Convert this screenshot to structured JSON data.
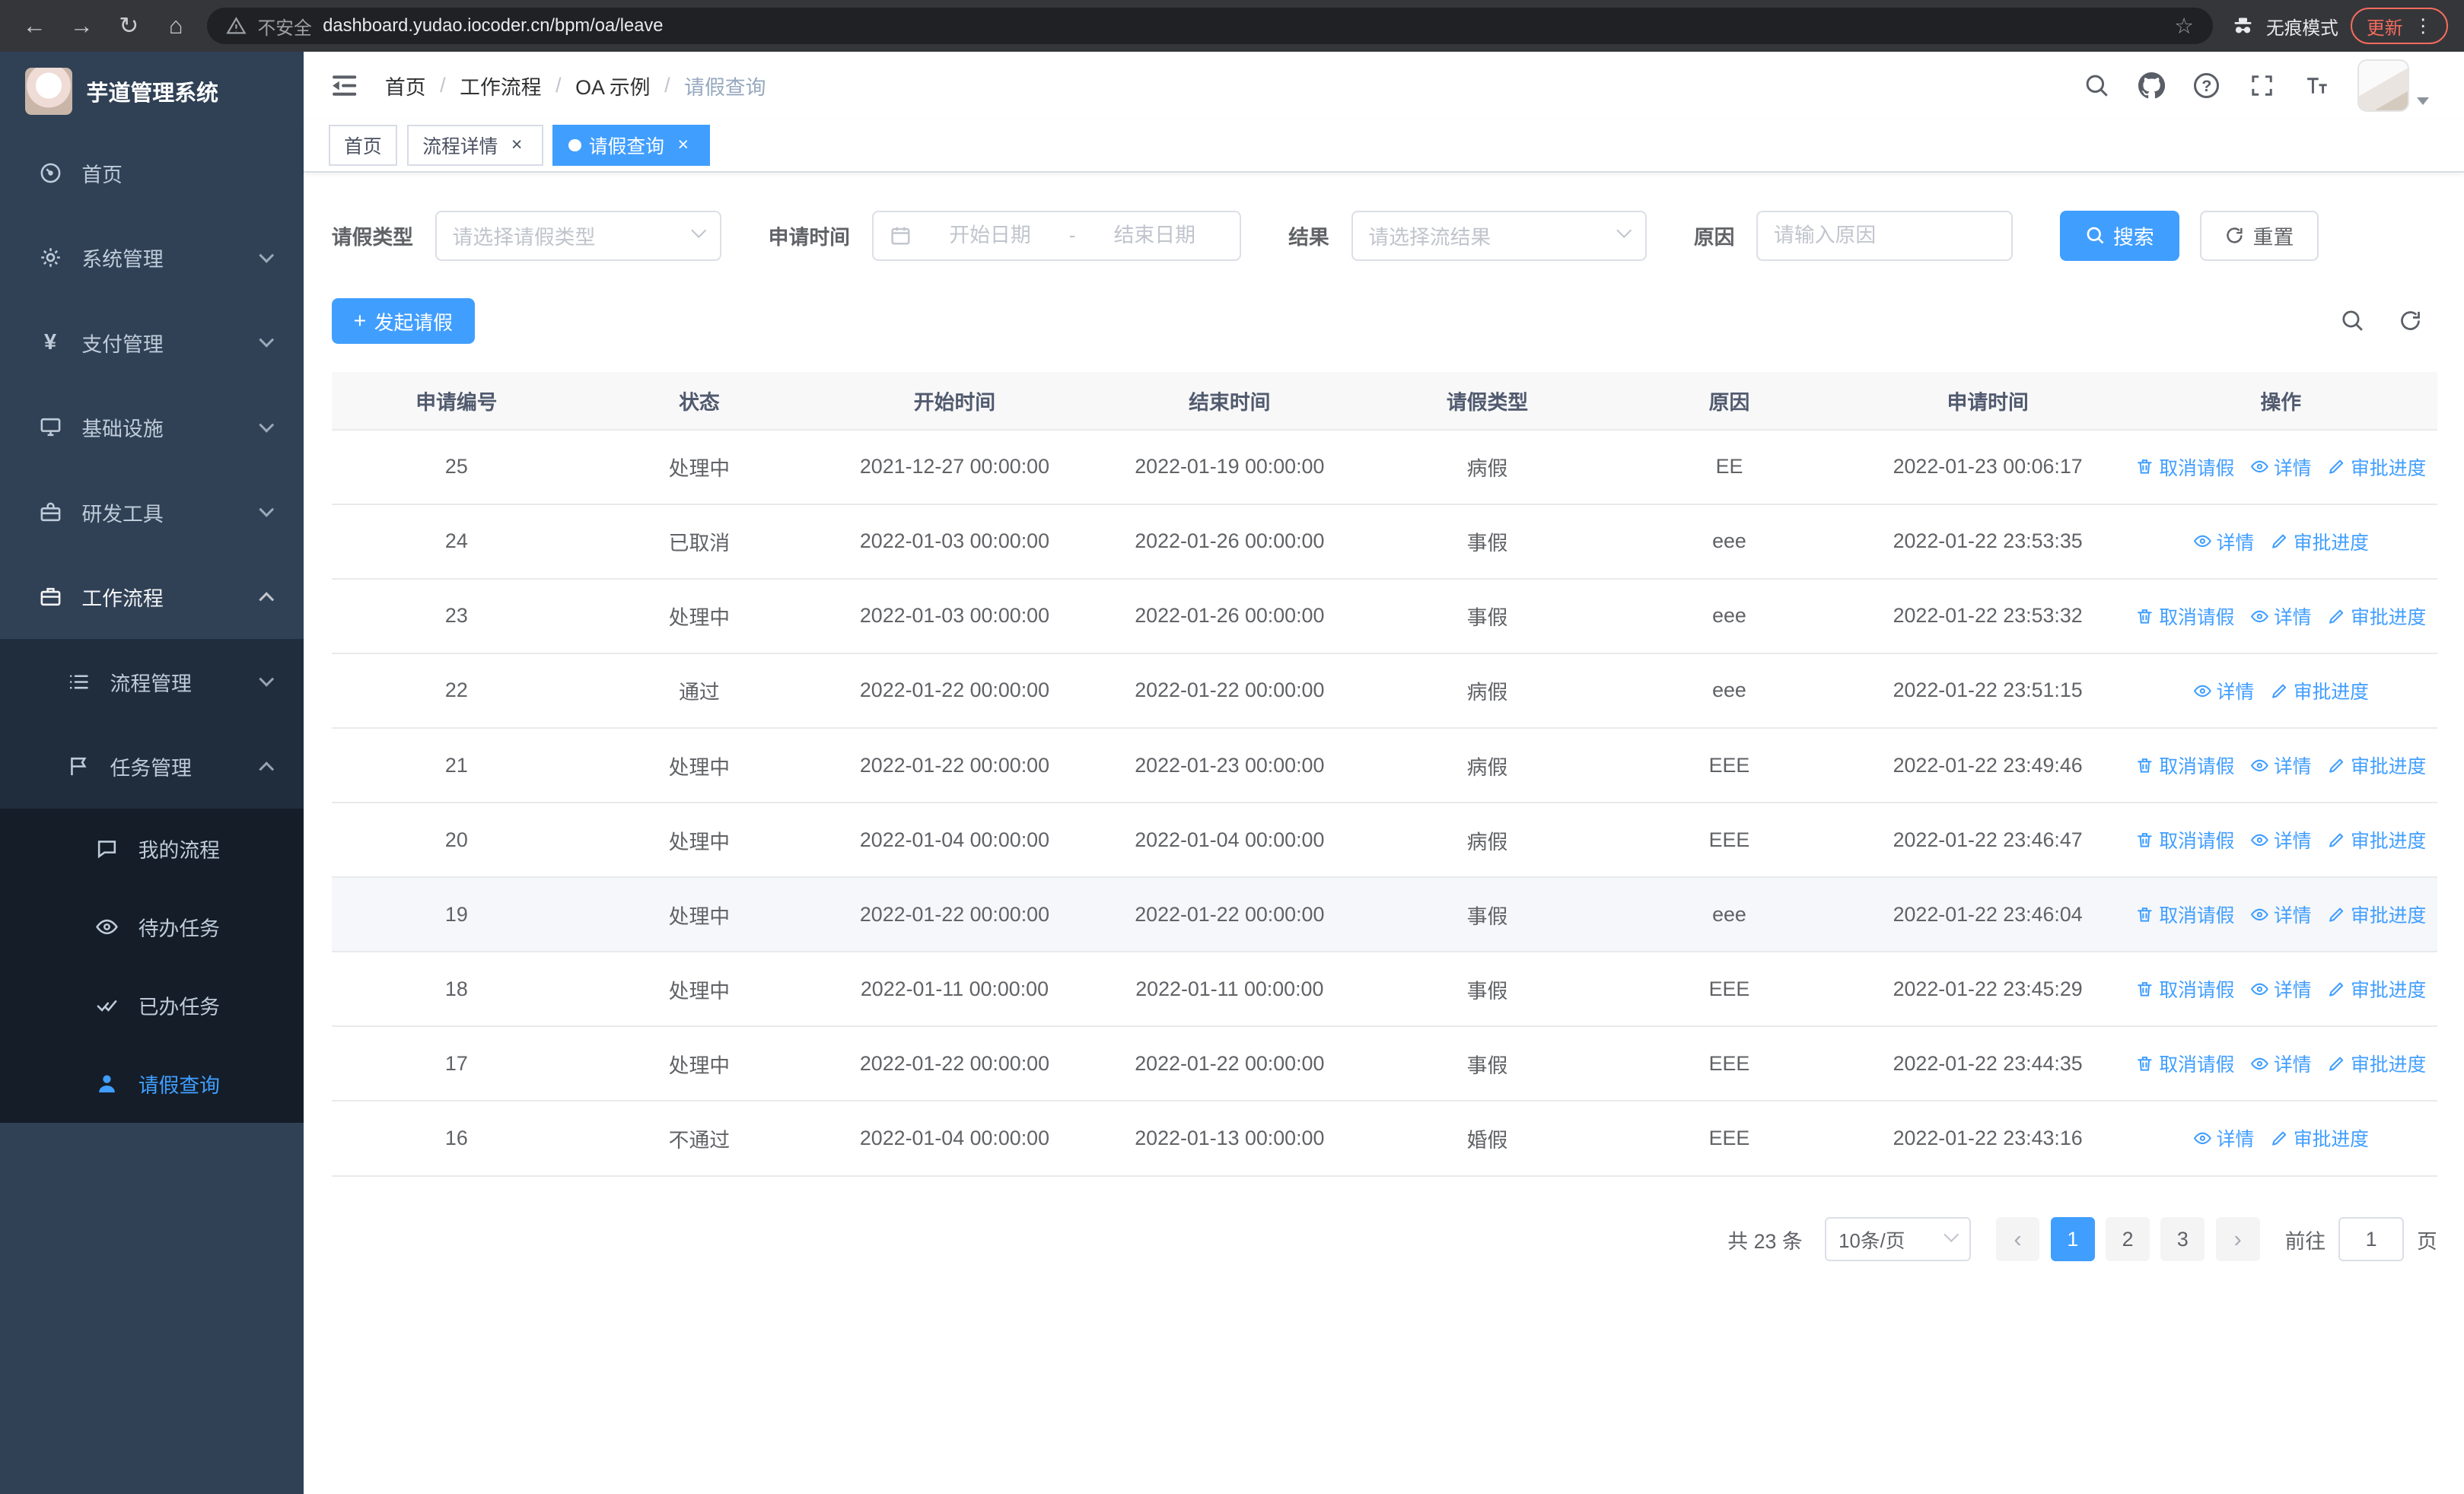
{
  "theme": {
    "accent": "#409eff",
    "sidebar_bg": "#304156",
    "submenu_bg": "#1f2d3d",
    "submenu_deep_bg": "#141d28",
    "update_accent": "#f46b5d"
  },
  "icons": {
    "back": "←",
    "forward": "→",
    "reload": "↻",
    "home": "⌂",
    "star": "☆",
    "menu_dots": "⋮",
    "question_mark": "?",
    "plus": "+",
    "close": "×",
    "prev": "‹",
    "next": "›",
    "breadcrumb_sep": "/"
  },
  "browser": {
    "security_warning": "不安全",
    "url": "dashboard.yudao.iocoder.cn/bpm/oa/leave",
    "incognito_label": "无痕模式",
    "update_label": "更新"
  },
  "sidebar": {
    "logo_title": "芋道管理系统",
    "items": [
      {
        "label": "首页"
      },
      {
        "label": "系统管理"
      },
      {
        "label": "支付管理"
      },
      {
        "label": "基础设施"
      },
      {
        "label": "研发工具"
      },
      {
        "label": "工作流程"
      },
      {
        "label": "流程管理"
      },
      {
        "label": "任务管理"
      },
      {
        "label": "我的流程"
      },
      {
        "label": "待办任务"
      },
      {
        "label": "已办任务"
      },
      {
        "label": "请假查询"
      }
    ]
  },
  "header": {
    "breadcrumb": [
      "首页",
      "工作流程",
      "OA 示例",
      "请假查询"
    ]
  },
  "tabs": [
    {
      "label": "首页"
    },
    {
      "label": "流程详情"
    },
    {
      "label": "请假查询"
    }
  ],
  "filters": {
    "type_label": "请假类型",
    "type_placeholder": "请选择请假类型",
    "time_label": "申请时间",
    "start_placeholder": "开始日期",
    "range_separator": "-",
    "end_placeholder": "结束日期",
    "result_label": "结果",
    "result_placeholder": "请选择流结果",
    "reason_label": "原因",
    "reason_placeholder": "请输入原因",
    "search_label": "搜索",
    "reset_label": "重置"
  },
  "toolbar": {
    "create_label": "发起请假"
  },
  "table": {
    "columns": [
      "申请编号",
      "状态",
      "开始时间",
      "结束时间",
      "请假类型",
      "原因",
      "申请时间",
      "操作"
    ],
    "action_labels": {
      "cancel": "取消请假",
      "detail": "详情",
      "progress": "审批进度"
    },
    "rows": [
      {
        "id": "25",
        "status": "处理中",
        "start": "2021-12-27 00:00:00",
        "end": "2022-01-19 00:00:00",
        "type": "病假",
        "reason": "EE",
        "apply": "2022-01-23 00:06:17",
        "cancelable": true,
        "hover": false
      },
      {
        "id": "24",
        "status": "已取消",
        "start": "2022-01-03 00:00:00",
        "end": "2022-01-26 00:00:00",
        "type": "事假",
        "reason": "eee",
        "apply": "2022-01-22 23:53:35",
        "cancelable": false,
        "hover": false
      },
      {
        "id": "23",
        "status": "处理中",
        "start": "2022-01-03 00:00:00",
        "end": "2022-01-26 00:00:00",
        "type": "事假",
        "reason": "eee",
        "apply": "2022-01-22 23:53:32",
        "cancelable": true,
        "hover": false
      },
      {
        "id": "22",
        "status": "通过",
        "start": "2022-01-22 00:00:00",
        "end": "2022-01-22 00:00:00",
        "type": "病假",
        "reason": "eee",
        "apply": "2022-01-22 23:51:15",
        "cancelable": false,
        "hover": false
      },
      {
        "id": "21",
        "status": "处理中",
        "start": "2022-01-22 00:00:00",
        "end": "2022-01-23 00:00:00",
        "type": "病假",
        "reason": "EEE",
        "apply": "2022-01-22 23:49:46",
        "cancelable": true,
        "hover": false
      },
      {
        "id": "20",
        "status": "处理中",
        "start": "2022-01-04 00:00:00",
        "end": "2022-01-04 00:00:00",
        "type": "病假",
        "reason": "EEE",
        "apply": "2022-01-22 23:46:47",
        "cancelable": true,
        "hover": false
      },
      {
        "id": "19",
        "status": "处理中",
        "start": "2022-01-22 00:00:00",
        "end": "2022-01-22 00:00:00",
        "type": "事假",
        "reason": "eee",
        "apply": "2022-01-22 23:46:04",
        "cancelable": true,
        "hover": true
      },
      {
        "id": "18",
        "status": "处理中",
        "start": "2022-01-11 00:00:00",
        "end": "2022-01-11 00:00:00",
        "type": "事假",
        "reason": "EEE",
        "apply": "2022-01-22 23:45:29",
        "cancelable": true,
        "hover": false
      },
      {
        "id": "17",
        "status": "处理中",
        "start": "2022-01-22 00:00:00",
        "end": "2022-01-22 00:00:00",
        "type": "事假",
        "reason": "EEE",
        "apply": "2022-01-22 23:44:35",
        "cancelable": true,
        "hover": false
      },
      {
        "id": "16",
        "status": "不通过",
        "start": "2022-01-04 00:00:00",
        "end": "2022-01-13 00:00:00",
        "type": "婚假",
        "reason": "EEE",
        "apply": "2022-01-22 23:43:16",
        "cancelable": false,
        "hover": false
      }
    ]
  },
  "pagination": {
    "total_label": "共 23 条",
    "page_size": "10条/页",
    "pages": [
      "1",
      "2",
      "3"
    ],
    "active_page": "1",
    "goto_label": "前往",
    "goto_value": "1",
    "page_unit": "页"
  }
}
